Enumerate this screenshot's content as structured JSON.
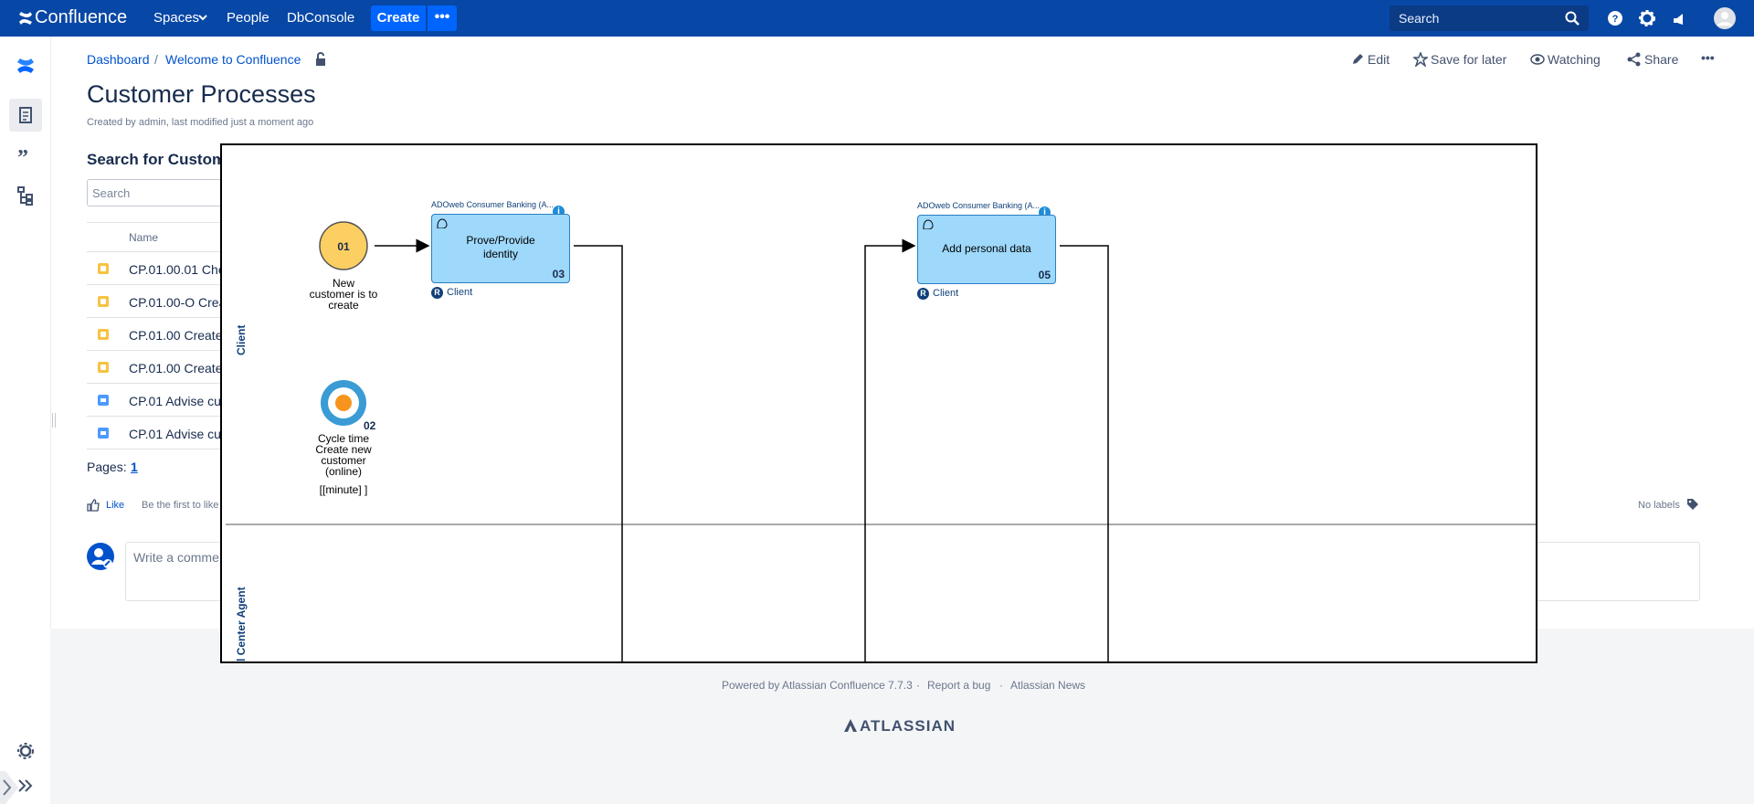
{
  "topnav": {
    "logo_label": "Confluence",
    "spaces_label": "Spaces",
    "people_label": "People",
    "dbconsole_label": "DbConsole",
    "create_label": "Create",
    "more_label": "•••",
    "search_placeholder": "Search"
  },
  "breadcrumb": {
    "dashboard": "Dashboard",
    "separator": "/",
    "welcome": "Welcome to Confluence"
  },
  "page": {
    "title": "Customer Processes",
    "byline": "Created by admin, last modified just a moment ago",
    "search_heading": "Search for Custom",
    "search_placeholder": "Search",
    "name_header": "Name",
    "rows": [
      "CP.01.00.01 Che",
      "CP.01.00-O Crea",
      "CP.01.00 Create",
      "CP.01.00 Create",
      "CP.01 Advise cu",
      "CP.01 Advise cu"
    ],
    "pages_label": "Pages:",
    "pages_value": "1",
    "like_label": "Like",
    "be_first": "Be the first to like",
    "no_labels": "No labels",
    "comment_placeholder": "Write a comme"
  },
  "actions": {
    "edit": "Edit",
    "save": "Save for later",
    "watching": "Watching",
    "share": "Share",
    "more": "•••"
  },
  "footer": {
    "powered": "Powered by Atlassian Confluence 7.7.3",
    "dot1": "·",
    "report": "Report a bug",
    "dot2": "·",
    "news": "Atlassian News",
    "brand": "ATLASSIAN"
  },
  "diagram": {
    "lane_client": "Client",
    "lane_agent": "l Center Agent",
    "start_number": "01",
    "start_text_1": "New",
    "start_text_2": "customer is to",
    "start_text_3": "create",
    "timer_number": "02",
    "timer_text_1": "Cycle time",
    "timer_text_2": "Create new",
    "timer_text_3": "customer",
    "timer_text_4": "(online)",
    "timer_unit": "[[minute]   ]",
    "task1_header": "ADOweb Consumer Banking (A...",
    "task1_line1": "Prove/Provide",
    "task1_line2": "identity",
    "task1_number": "03",
    "task1_role": "Client",
    "task2_header": "ADOweb Consumer Banking (A...",
    "task2_line1": "Add personal data",
    "task2_number": "05",
    "task2_role": "Client",
    "role_badge": "R",
    "info_badge": "i",
    "colors": {
      "task_fill": "#9ed8fb",
      "start_fill": "#fccf62",
      "timer_ring": "#3a9bd5",
      "timer_core": "#f7941d"
    }
  }
}
